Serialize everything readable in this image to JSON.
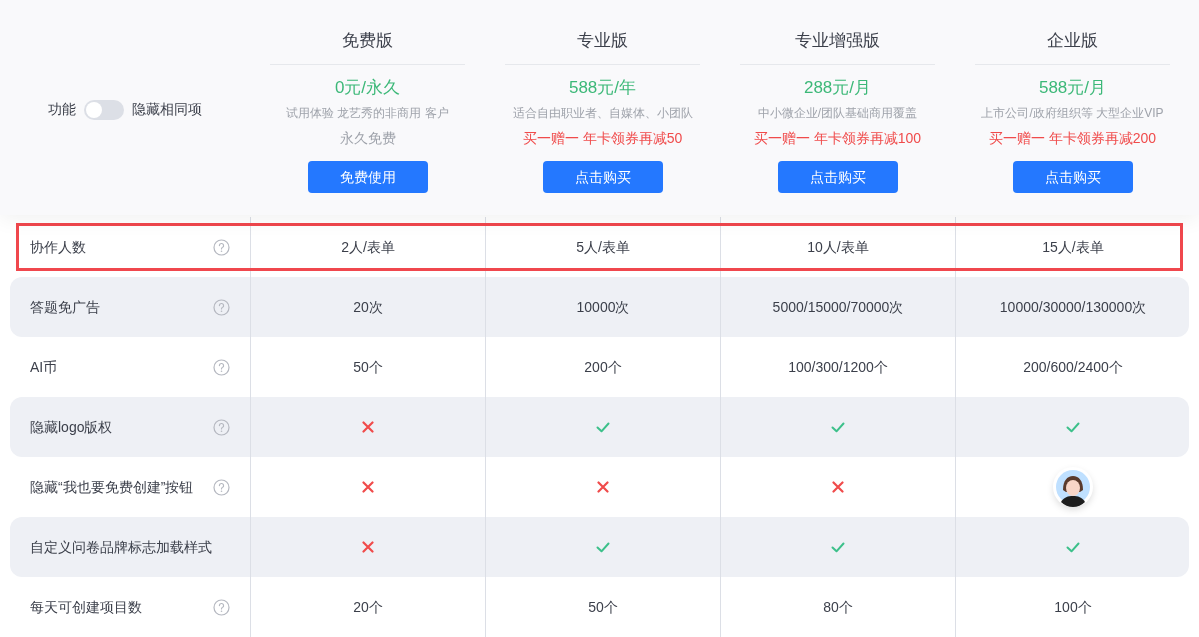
{
  "filter": {
    "label": "功能",
    "toggle_on": false,
    "toggle_label": "隐藏相同项"
  },
  "plans": [
    {
      "name": "免费版",
      "price": "0元/永久",
      "description": "试用体验 龙艺秀的非商用 客户",
      "offer": {
        "kind": "note",
        "text": "永久免费"
      },
      "button": "免费使用"
    },
    {
      "name": "专业版",
      "price": "588元/年",
      "description": "适合自由职业者、自媒体、小团队",
      "offer": {
        "kind": "promo",
        "text": "买一赠一 年卡领券再减50"
      },
      "button": "点击购买"
    },
    {
      "name": "专业增强版",
      "price": "288元/月",
      "description": "中小微企业/团队基础商用覆盖",
      "offer": {
        "kind": "promo",
        "text": "买一赠一 年卡领券再减100"
      },
      "button": "点击购买"
    },
    {
      "name": "企业版",
      "price": "588元/月",
      "description": "上市公司/政府组织等 大型企业VIP",
      "offer": {
        "kind": "promo",
        "text": "买一赠一 年卡领券再减200"
      },
      "button": "点击购买"
    }
  ],
  "features": [
    {
      "label": "协作人数",
      "help": true,
      "highlighted": true,
      "cells": [
        {
          "kind": "text",
          "text": "2人/表单"
        },
        {
          "kind": "text",
          "text": "5人/表单"
        },
        {
          "kind": "text",
          "text": "10人/表单"
        },
        {
          "kind": "text",
          "text": "15人/表单"
        }
      ]
    },
    {
      "label": "答题免广告",
      "help": true,
      "highlighted": false,
      "cells": [
        {
          "kind": "text",
          "text": "20次"
        },
        {
          "kind": "text",
          "text": "10000次"
        },
        {
          "kind": "text",
          "text": "5000/15000/70000次"
        },
        {
          "kind": "text",
          "text": "10000/30000/130000次"
        }
      ]
    },
    {
      "label": "AI币",
      "help": true,
      "highlighted": false,
      "cells": [
        {
          "kind": "text",
          "text": "50个"
        },
        {
          "kind": "text",
          "text": "200个"
        },
        {
          "kind": "text",
          "text": "100/300/1200个"
        },
        {
          "kind": "text",
          "text": "200/600/2400个"
        }
      ]
    },
    {
      "label": "隐藏logo版权",
      "help": true,
      "highlighted": false,
      "cells": [
        {
          "kind": "no"
        },
        {
          "kind": "yes"
        },
        {
          "kind": "yes"
        },
        {
          "kind": "yes"
        }
      ]
    },
    {
      "label": "隐藏“我也要免费创建”按钮",
      "help": true,
      "highlighted": false,
      "cells": [
        {
          "kind": "no"
        },
        {
          "kind": "no"
        },
        {
          "kind": "no"
        },
        {
          "kind": "avatar"
        }
      ]
    },
    {
      "label": "自定义问卷品牌标志加载样式",
      "help": false,
      "highlighted": false,
      "cells": [
        {
          "kind": "no"
        },
        {
          "kind": "yes"
        },
        {
          "kind": "yes"
        },
        {
          "kind": "yes"
        }
      ]
    },
    {
      "label": "每天可创建项目数",
      "help": true,
      "highlighted": false,
      "cells": [
        {
          "kind": "text",
          "text": "20个"
        },
        {
          "kind": "text",
          "text": "50个"
        },
        {
          "kind": "text",
          "text": "80个"
        },
        {
          "kind": "text",
          "text": "100个"
        }
      ]
    }
  ]
}
